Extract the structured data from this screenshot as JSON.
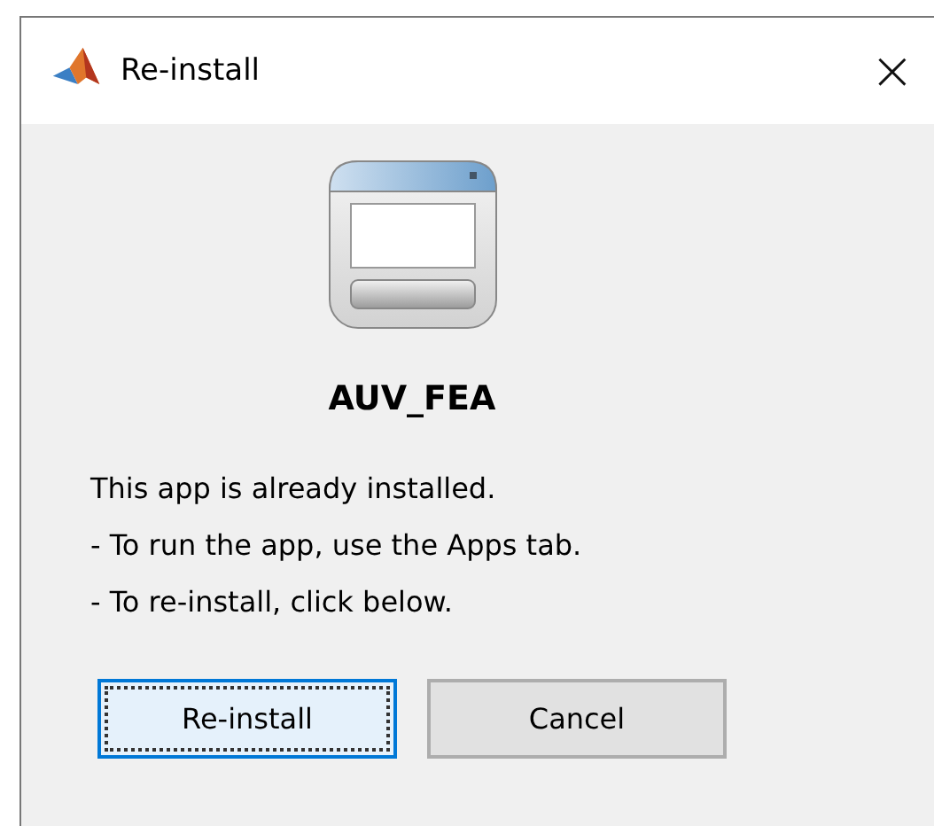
{
  "window": {
    "title": "Re-install",
    "close": "×"
  },
  "app_name": "AUV_FEA",
  "message": [
    "This app is already installed.",
    "- To run the app, use the Apps tab.",
    "- To re-install, click below."
  ],
  "buttons": [
    {
      "label": "Re-install",
      "focused": true
    },
    {
      "label": "Cancel",
      "focused": false
    }
  ]
}
